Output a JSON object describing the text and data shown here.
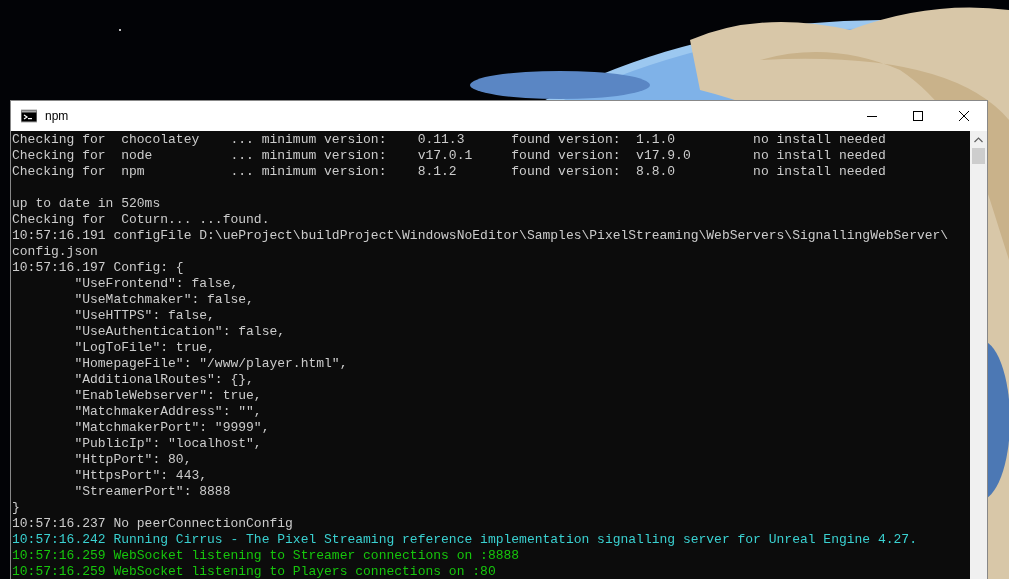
{
  "window": {
    "title": "npm"
  },
  "console": {
    "blocks": [
      {
        "lines": [
          {
            "text": "Checking for  chocolatey    ... minimum version:    0.11.3      found version:  1.1.0          no install needed",
            "kind": "default"
          },
          {
            "text": "Checking for  node          ... minimum version:    v17.0.1     found version:  v17.9.0        no install needed",
            "kind": "default"
          },
          {
            "text": "Checking for  npm           ... minimum version:    8.1.2       found version:  8.8.0          no install needed",
            "kind": "default"
          }
        ]
      },
      {
        "lines": [
          {
            "text": "up to date in 520ms",
            "kind": "default"
          },
          {
            "text": "Checking for  Coturn... ...found.",
            "kind": "default"
          },
          {
            "text": "10:57:16.191 configFile D:\\ueProject\\buildProject\\WindowsNoEditor\\Samples\\PixelStreaming\\WebServers\\SignallingWebServer\\",
            "kind": "default"
          },
          {
            "text": "config.json",
            "kind": "default"
          },
          {
            "text": "10:57:16.197 Config: {",
            "kind": "default"
          },
          {
            "text": "        \"UseFrontend\": false,",
            "kind": "default"
          },
          {
            "text": "        \"UseMatchmaker\": false,",
            "kind": "default"
          },
          {
            "text": "        \"UseHTTPS\": false,",
            "kind": "default"
          },
          {
            "text": "        \"UseAuthentication\": false,",
            "kind": "default"
          },
          {
            "text": "        \"LogToFile\": true,",
            "kind": "default"
          },
          {
            "text": "        \"HomepageFile\": \"/www/player.html\",",
            "kind": "default"
          },
          {
            "text": "        \"AdditionalRoutes\": {},",
            "kind": "default"
          },
          {
            "text": "        \"EnableWebserver\": true,",
            "kind": "default"
          },
          {
            "text": "        \"MatchmakerAddress\": \"\",",
            "kind": "default"
          },
          {
            "text": "        \"MatchmakerPort\": \"9999\",",
            "kind": "default"
          },
          {
            "text": "        \"PublicIp\": \"localhost\",",
            "kind": "default"
          },
          {
            "text": "        \"HttpPort\": 80,",
            "kind": "default"
          },
          {
            "text": "        \"HttpsPort\": 443,",
            "kind": "default"
          },
          {
            "text": "        \"StreamerPort\": 8888",
            "kind": "default"
          },
          {
            "text": "}",
            "kind": "default"
          },
          {
            "text": "10:57:16.237 No peerConnectionConfig",
            "kind": "default"
          },
          {
            "text": "10:57:16.242 Running Cirrus - The Pixel Streaming reference implementation signalling server for Unreal Engine 4.27.",
            "kind": "info"
          },
          {
            "text": "10:57:16.259 WebSocket listening to Streamer connections on :8888",
            "kind": "success"
          },
          {
            "text": "10:57:16.259 WebSocket listening to Players connections on :80",
            "kind": "success"
          }
        ]
      }
    ]
  }
}
